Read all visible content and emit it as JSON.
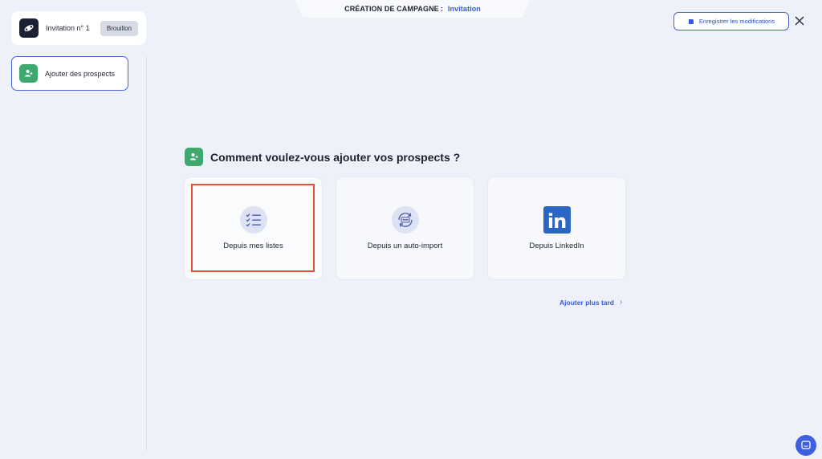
{
  "header": {
    "title_prefix": "CRÉATION DE CAMPAGNE",
    "separator": ":",
    "campaign_type": "Invitation"
  },
  "sidebar": {
    "campaign": {
      "name": "Invitation n° 1",
      "status": "Brouillon",
      "logo_icon": "rocket-icon"
    },
    "steps": [
      {
        "label": "Ajouter des prospects",
        "icon": "user-add-icon",
        "active": true
      }
    ]
  },
  "toolbar": {
    "save_label": "Enregistrer les modifications",
    "save_icon": "save-icon",
    "close_icon": "close-icon"
  },
  "main": {
    "title": "Comment voulez-vous ajouter vos prospects ?",
    "title_icon": "user-add-icon",
    "options": [
      {
        "label": "Depuis mes listes",
        "icon": "checklist-icon",
        "highlighted": true
      },
      {
        "label": "Depuis un auto-import",
        "icon": "csv-sync-icon",
        "highlighted": false
      },
      {
        "label": "Depuis LinkedIn",
        "icon": "linkedin-icon",
        "highlighted": false
      }
    ],
    "later_link": "Ajouter plus tard",
    "later_icon": "chevron-right-icon"
  },
  "colors": {
    "accent": "#3a5bd9",
    "green": "#3fa86f",
    "highlight": "#e2523a",
    "background": "#eef1f9",
    "linkedin": "#2c66c3"
  }
}
